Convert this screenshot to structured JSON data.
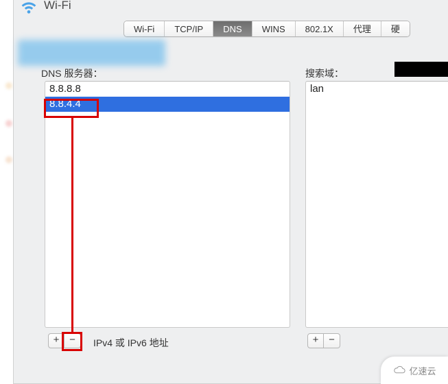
{
  "header": {
    "title": "Wi-Fi"
  },
  "tabs": {
    "items": [
      {
        "label": "Wi-Fi",
        "active": false
      },
      {
        "label": "TCP/IP",
        "active": false
      },
      {
        "label": "DNS",
        "active": true
      },
      {
        "label": "WINS",
        "active": false
      },
      {
        "label": "802.1X",
        "active": false
      },
      {
        "label": "代理",
        "active": false
      },
      {
        "label": "硬",
        "active": false
      }
    ]
  },
  "dns_section": {
    "label": "DNS 服务器：",
    "servers": [
      {
        "value": "8.8.8.8",
        "selected": false
      },
      {
        "value": "8.8.4.4",
        "selected": true
      }
    ],
    "add_label": "+",
    "remove_label": "−",
    "hint": "IPv4 或 IPv6 地址"
  },
  "search_section": {
    "label": "搜索域：",
    "domains": [
      {
        "value": "lan",
        "selected": false
      }
    ],
    "add_label": "+",
    "remove_label": "−"
  },
  "watermark": {
    "text": "亿速云"
  },
  "annotation": {
    "boxes": [
      "dns-entry-8.8.4.4",
      "remove-button"
    ],
    "purpose": "highlight selected entry and remove button"
  }
}
